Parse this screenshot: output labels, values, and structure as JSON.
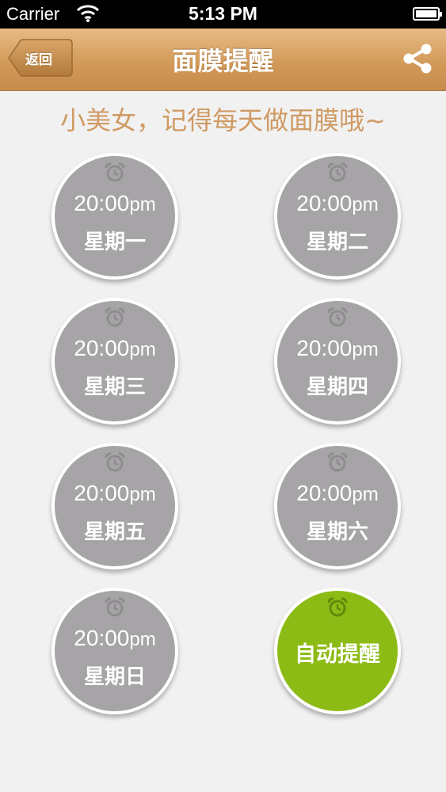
{
  "status_bar": {
    "carrier": "Carrier",
    "time": "5:13 PM"
  },
  "nav": {
    "back_label": "返回",
    "title": "面膜提醒",
    "share_icon": "share-icon"
  },
  "subtitle": "小美女，记得每天做面膜哦~",
  "reminders": [
    {
      "time": "20:00",
      "suffix": "pm",
      "day": "星期一"
    },
    {
      "time": "20:00",
      "suffix": "pm",
      "day": "星期二"
    },
    {
      "time": "20:00",
      "suffix": "pm",
      "day": "星期三"
    },
    {
      "time": "20:00",
      "suffix": "pm",
      "day": "星期四"
    },
    {
      "time": "20:00",
      "suffix": "pm",
      "day": "星期五"
    },
    {
      "time": "20:00",
      "suffix": "pm",
      "day": "星期六"
    },
    {
      "time": "20:00",
      "suffix": "pm",
      "day": "星期日"
    }
  ],
  "auto_reminder": {
    "label": "自动提醒"
  },
  "colors": {
    "nav_gradient_top": "#e7bb86",
    "nav_gradient_bottom": "#c58c4c",
    "subtitle": "#cf9a63",
    "circle_gray": "#a6a4a6",
    "circle_green": "#8dbb16",
    "background": "#f1f1f1"
  }
}
